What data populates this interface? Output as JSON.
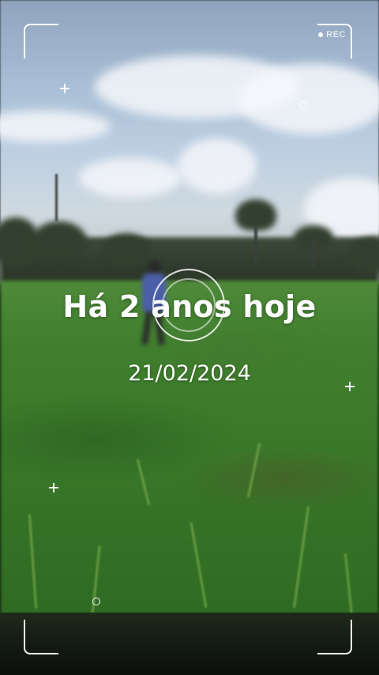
{
  "overlay": {
    "rec_label": "REC",
    "headline": "Há 2 anos hoje",
    "date": "21/02/2024"
  },
  "icons": {
    "rec_indicator": "record-dot-icon",
    "crosshair": "plus-icon",
    "focus": "focus-ring-icon",
    "marker": "circle-marker-icon"
  },
  "colors": {
    "overlay_text": "#ffffff",
    "grass": "#3b7a2a",
    "sky": "#a9bfd6"
  }
}
